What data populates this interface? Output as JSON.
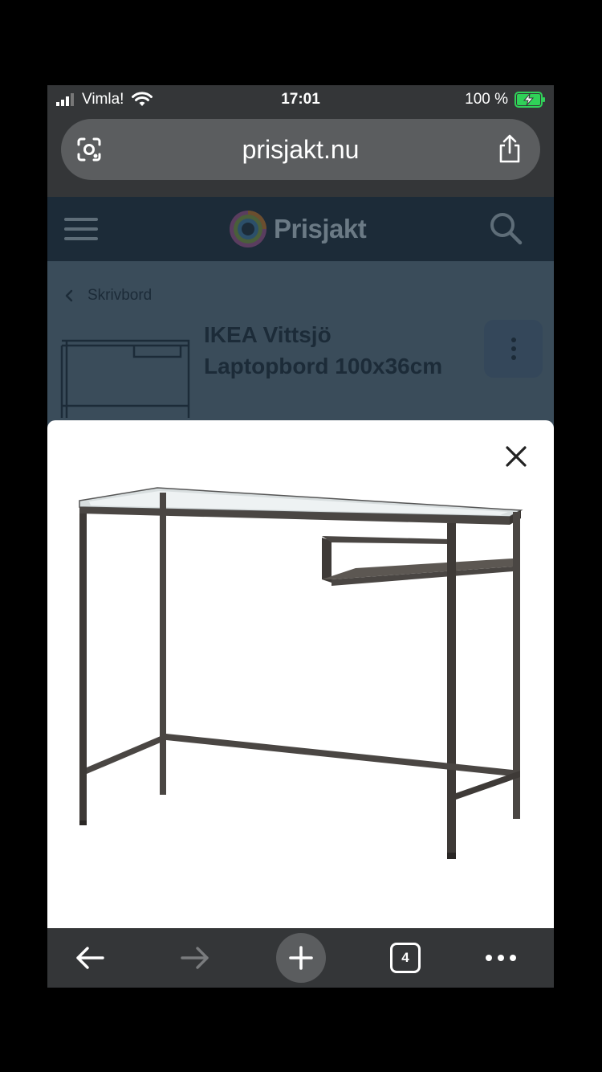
{
  "status_bar": {
    "carrier": "Vimla!",
    "time": "17:01",
    "battery_percent": "100 %",
    "battery_level": 1.0,
    "signal_icon": "signal-bars-icon",
    "wifi_icon": "wifi-icon",
    "battery_icon": "battery-charging-icon"
  },
  "browser": {
    "url": "prisjakt.nu",
    "lens_icon": "lens-icon",
    "share_icon": "share-icon"
  },
  "site_header": {
    "logo_text": "Prisjakt",
    "menu_icon": "menu-icon",
    "search_icon": "search-icon"
  },
  "page": {
    "breadcrumb": "Skrivbord",
    "product_title": "IKEA Vittsjö Laptopbord 100x36cm",
    "more_icon": "kebab-icon"
  },
  "modal": {
    "close_icon": "close-icon",
    "image_subject": "desk-image"
  },
  "toolbar": {
    "back_icon": "arrow-left-icon",
    "forward_icon": "arrow-right-icon",
    "new_tab_icon": "plus-icon",
    "tab_count": "4",
    "more_icon": "more-horizontal-icon"
  },
  "colors": {
    "browser_chrome": "#343638",
    "site_header": "#1c2b38",
    "page_overlay": "#3a4c5a",
    "battery_green": "#30d158"
  }
}
